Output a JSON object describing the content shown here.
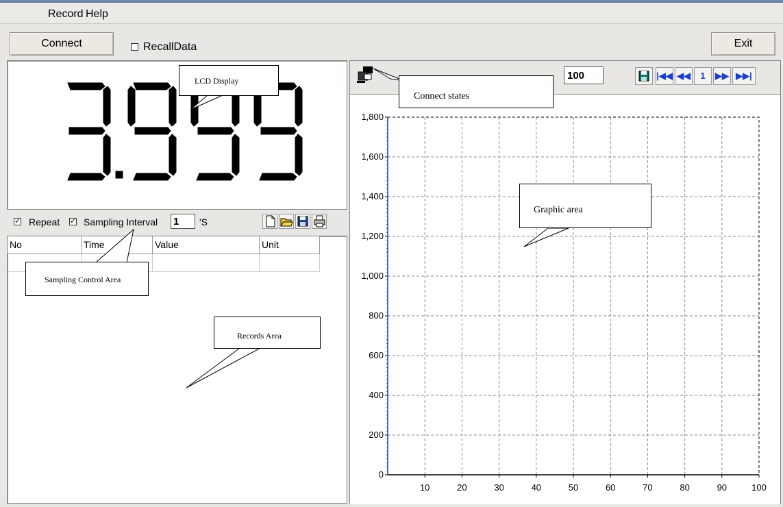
{
  "menu": {
    "record": "Record",
    "help": "Help"
  },
  "toolbar": {
    "connect": "Connect",
    "recall_label": "RecallData",
    "recall_checked": false,
    "exit": "Exit"
  },
  "lcd": {
    "value": "3.999"
  },
  "sampling": {
    "repeat_label": "Repeat",
    "repeat_checked": true,
    "interval_label": "Sampling Interval",
    "interval_checked": true,
    "interval_value": "1",
    "unit_label": "'S"
  },
  "records": {
    "columns": [
      "No",
      "Time",
      "Value",
      "Unit"
    ]
  },
  "graph_toolbar": {
    "points_value": "100",
    "page": "1"
  },
  "annotations": {
    "lcd": "LCD Display",
    "connect": "Connect states",
    "sampling": "Sampling Control Area",
    "records": "Records Area",
    "graphic": "Graphic area"
  },
  "chart_data": {
    "type": "line",
    "title": "",
    "xlabel": "",
    "ylabel": "",
    "xlim": [
      0,
      100
    ],
    "ylim": [
      0,
      1800
    ],
    "x_ticks": [
      "10",
      "20",
      "30",
      "40",
      "50",
      "60",
      "70",
      "80",
      "90",
      "100"
    ],
    "y_ticks": [
      "0",
      "200",
      "400",
      "600",
      "800",
      "1,000",
      "1,200",
      "1,400",
      "1,600",
      "1,800"
    ],
    "grid": true,
    "series": []
  },
  "colors": {
    "accent": "#1a3fd0",
    "grid": "#888888"
  }
}
